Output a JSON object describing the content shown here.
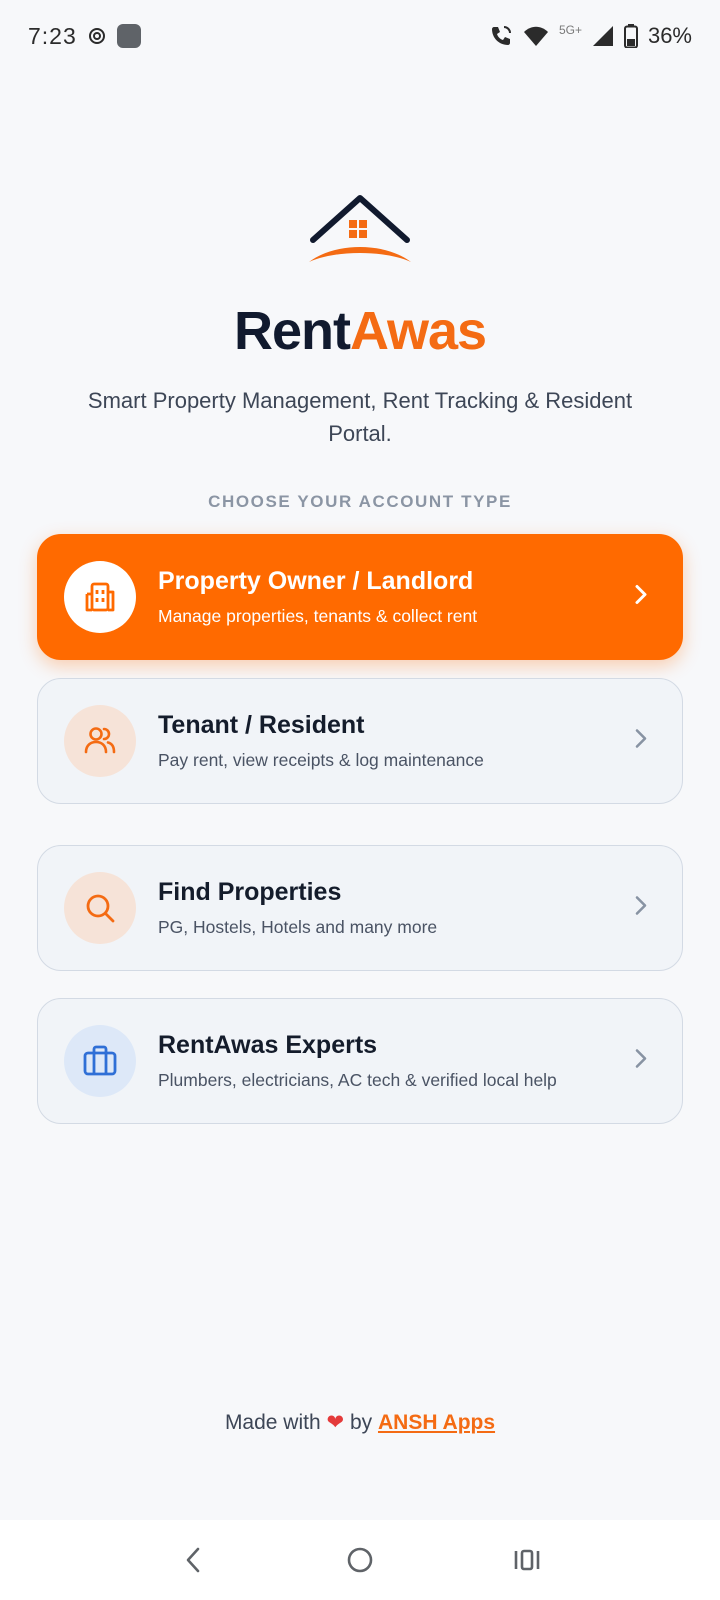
{
  "status_bar": {
    "time": "7:23",
    "network_label": "5G+",
    "battery": "36%",
    "icons": [
      "hotspot-icon",
      "app-notification-icon",
      "wifi-calling-icon",
      "wifi-icon",
      "signal-icon",
      "battery-icon"
    ]
  },
  "brand": {
    "name_part1": "Rent",
    "name_part2": "Awas",
    "tagline": "Smart Property Management, Rent Tracking & Resident Portal."
  },
  "section_label": "CHOOSE YOUR ACCOUNT TYPE",
  "account_types": [
    {
      "title": "Property Owner / Landlord",
      "description": "Manage properties, tenants & collect rent",
      "icon": "building-icon"
    },
    {
      "title": "Tenant / Resident",
      "description": "Pay rent, view receipts & log maintenance",
      "icon": "users-icon"
    },
    {
      "title": "Find Properties",
      "description": "PG, Hostels, Hotels and many more",
      "icon": "search-icon"
    },
    {
      "title": "RentAwas Experts",
      "description": "Plumbers, electricians, AC tech & verified local help",
      "icon": "briefcase-icon"
    }
  ],
  "footer": {
    "prefix": "Made with",
    "middle": "by",
    "link": "ANSH Apps"
  },
  "colors": {
    "accent": "#ff6a00",
    "brand_dark": "#111a2e",
    "brand_orange": "#f46b13",
    "background": "#f7f8fa"
  }
}
